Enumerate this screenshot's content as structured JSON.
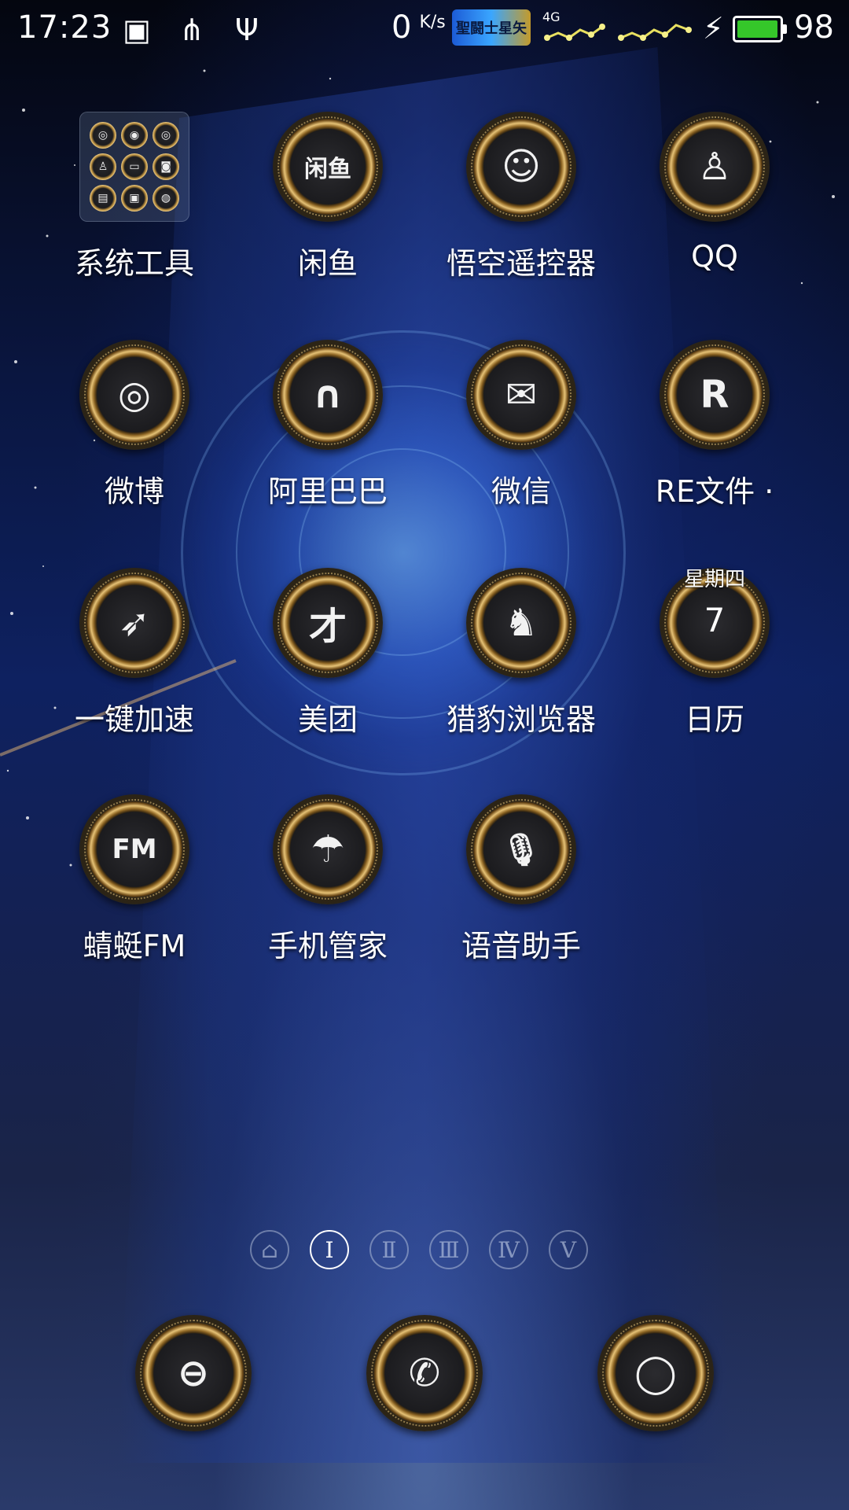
{
  "status_bar": {
    "time": "17:23",
    "net_speed_value": "0",
    "net_speed_unit": "K/s",
    "network_type": "4G",
    "battery_percent": "98",
    "battery_level": 0.98,
    "battery_color": "#35c72a",
    "left_icons": [
      "image-icon",
      "share-icon",
      "usb-icon"
    ],
    "logo_text": "聖闘士星矢"
  },
  "folder": {
    "label": "系统工具"
  },
  "apps": [
    {
      "label": "闲鱼",
      "icon": "闲鱼"
    },
    {
      "label": "悟空遥控器",
      "icon": "☺"
    },
    {
      "label": "QQ",
      "icon": "♙"
    },
    {
      "label": "微博",
      "icon": "◎"
    },
    {
      "label": "阿里巴巴",
      "icon": "∩"
    },
    {
      "label": "微信",
      "icon": "✉"
    },
    {
      "label": "RE文件 ·",
      "icon": "R"
    },
    {
      "label": "一键加速",
      "icon": "➶"
    },
    {
      "label": "美团",
      "icon": "才"
    },
    {
      "label": "猎豹浏览器",
      "icon": "♞"
    },
    {
      "label": "日历",
      "icon": ""
    },
    {
      "label": "蜻蜓FM",
      "icon": "FM"
    },
    {
      "label": "手机管家",
      "icon": "☂"
    },
    {
      "label": "语音助手",
      "icon": "🎙"
    }
  ],
  "calendar": {
    "weekday": "星期四",
    "date": "7"
  },
  "pager": {
    "pages": [
      "⌂",
      "Ⅰ",
      "Ⅱ",
      "Ⅲ",
      "Ⅳ",
      "Ⅴ"
    ],
    "active_index": 1
  },
  "dock": [
    {
      "name": "browser",
      "icon": "⊖"
    },
    {
      "name": "phone",
      "icon": "✆"
    },
    {
      "name": "messages",
      "icon": "◯"
    }
  ]
}
